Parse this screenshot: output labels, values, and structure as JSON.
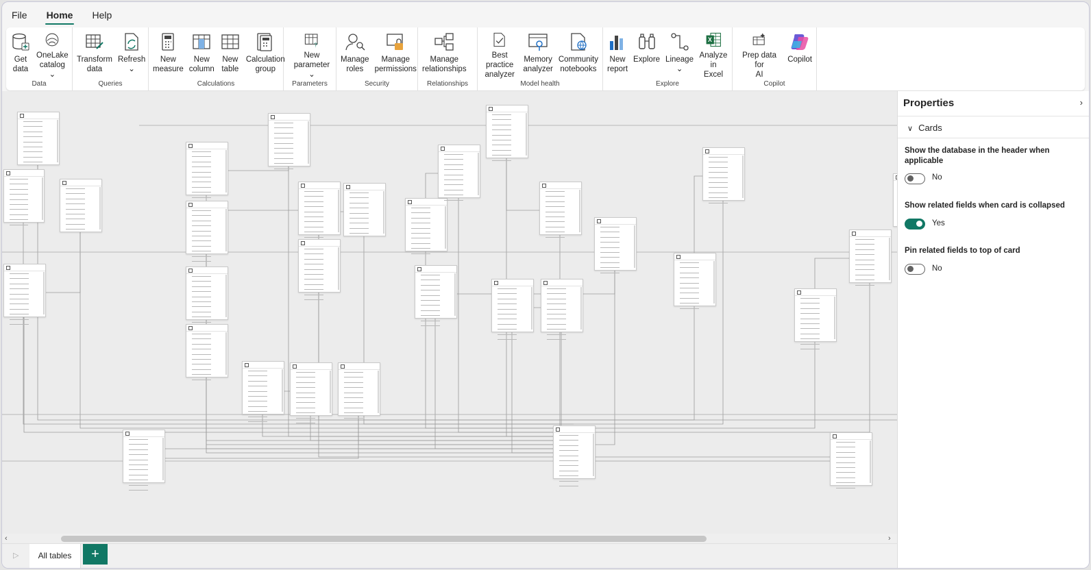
{
  "menu": {
    "file": "File",
    "home": "Home",
    "help": "Help"
  },
  "ribbon": {
    "groups": [
      {
        "label": "Data",
        "buttons": [
          "Get\ndata",
          "OneLake\ncatalog ⌄"
        ]
      },
      {
        "label": "Queries",
        "buttons": [
          "Transform\ndata",
          "Refresh\n⌄"
        ]
      },
      {
        "label": "Calculations",
        "buttons": [
          "New\nmeasure",
          "New\ncolumn",
          "New\ntable",
          "Calculation\ngroup"
        ]
      },
      {
        "label": "Parameters",
        "buttons": [
          "New\nparameter ⌄"
        ]
      },
      {
        "label": "Security",
        "buttons": [
          "Manage\nroles",
          "Manage\npermissions"
        ]
      },
      {
        "label": "Relationships",
        "buttons": [
          "Manage\nrelationships"
        ]
      },
      {
        "label": "Model health",
        "buttons": [
          "Best practice\nanalyzer",
          "Memory\nanalyzer",
          "Community\nnotebooks"
        ]
      },
      {
        "label": "Explore",
        "buttons": [
          "New\nreport",
          "Explore",
          "Lineage\n⌄",
          "Analyze in\nExcel"
        ]
      },
      {
        "label": "Copilot",
        "buttons": [
          "Prep data for\nAI",
          "Copilot"
        ]
      }
    ]
  },
  "properties": {
    "title": "Properties",
    "section": "Cards",
    "opt1_label": "Show the database in the header when applicable",
    "opt1_value": "No",
    "opt2_label": "Show related fields when card is collapsed",
    "opt2_value": "Yes",
    "opt3_label": "Pin related fields to top of card",
    "opt3_value": "No"
  },
  "tabs": {
    "all_tables": "All tables",
    "add": "+"
  },
  "colors": {
    "accent": "#117865"
  }
}
